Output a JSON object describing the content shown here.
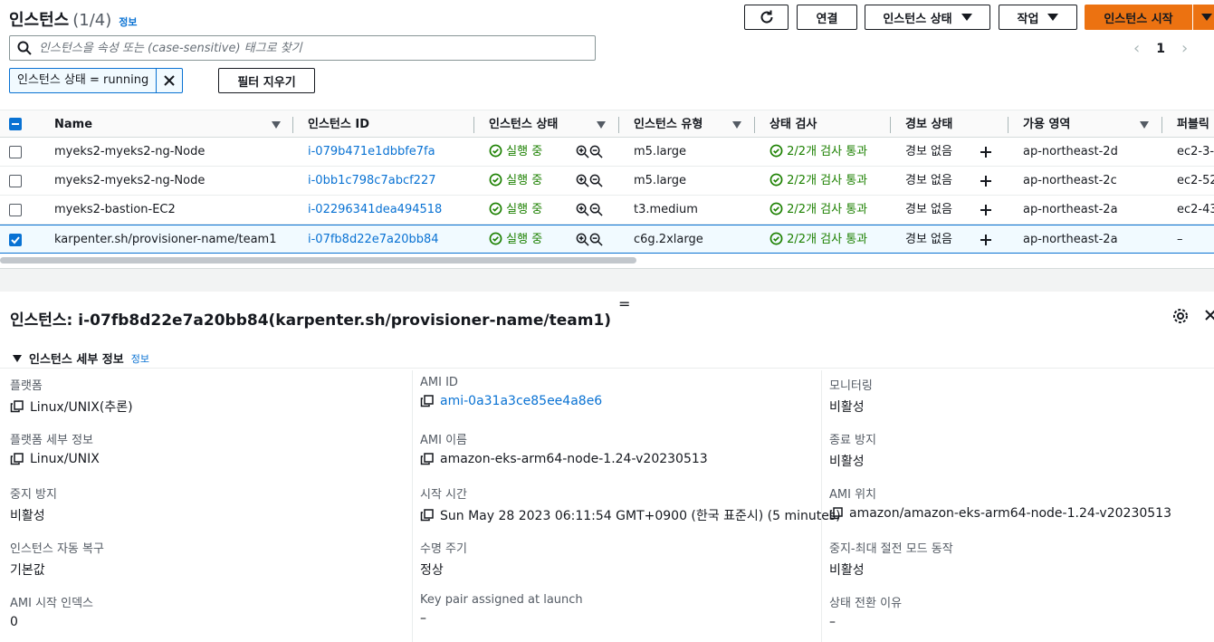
{
  "header": {
    "title": "인스턴스",
    "count": "(1/4)",
    "info": "정보"
  },
  "toolbar": {
    "connect": "연결",
    "instance_state": "인스턴스 상태",
    "actions": "작업",
    "launch": "인스턴스 시작"
  },
  "search": {
    "placeholder": "인스턴스을 속성 또는 (case-sensitive) 태그로 찾기"
  },
  "pagination": {
    "page": "1"
  },
  "filter": {
    "token": "인스턴스 상태 = running",
    "clear": "필터 지우기"
  },
  "table": {
    "columns": [
      "Name",
      "인스턴스 ID",
      "인스턴스 상태",
      "인스턴스 유형",
      "상태 검사",
      "경보 상태",
      "가용 영역",
      "퍼블릭"
    ],
    "rows": [
      {
        "name": "myeks2-myeks2-ng-Node",
        "id": "i-079b471e1dbbfe7fa",
        "state": "실행 중",
        "type": "m5.large",
        "check": "2/2개 검사 통과",
        "alarm": "경보 없음",
        "az": "ap-northeast-2d",
        "public": "ec2-3-",
        "selected": false
      },
      {
        "name": "myeks2-myeks2-ng-Node",
        "id": "i-0bb1c798c7abcf227",
        "state": "실행 중",
        "type": "m5.large",
        "check": "2/2개 검사 통과",
        "alarm": "경보 없음",
        "az": "ap-northeast-2c",
        "public": "ec2-52",
        "selected": false
      },
      {
        "name": "myeks2-bastion-EC2",
        "id": "i-02296341dea494518",
        "state": "실행 중",
        "type": "t3.medium",
        "check": "2/2개 검사 통과",
        "alarm": "경보 없음",
        "az": "ap-northeast-2a",
        "public": "ec2-43",
        "selected": false
      },
      {
        "name": "karpenter.sh/provisioner-name/team1",
        "id": "i-07fb8d22e7a20bb84",
        "state": "실행 중",
        "type": "c6g.2xlarge",
        "check": "2/2개 검사 통과",
        "alarm": "경보 없음",
        "az": "ap-northeast-2a",
        "public": "–",
        "selected": true
      }
    ]
  },
  "detail": {
    "title": "인스턴스: i-07fb8d22e7a20bb84(karpenter.sh/provisioner-name/team1)",
    "section": "인스턴스 세부 정보",
    "section_info": "정보",
    "col1": [
      {
        "label": "플랫폼",
        "value": "Linux/UNIX(추론)",
        "copy": true
      },
      {
        "label": "플랫폼 세부 정보",
        "value": "Linux/UNIX",
        "copy": true
      },
      {
        "label": "중지 방지",
        "value": "비활성",
        "copy": false
      },
      {
        "label": "인스턴스 자동 복구",
        "value": "기본값",
        "copy": false
      },
      {
        "label": "AMI 시작 인덱스",
        "value": "0",
        "copy": false
      }
    ],
    "col2": [
      {
        "label": "AMI ID",
        "value": "ami-0a31a3ce85ee4a8e6",
        "copy": true,
        "link": true
      },
      {
        "label": "AMI 이름",
        "value": "amazon-eks-arm64-node-1.24-v20230513",
        "copy": true
      },
      {
        "label": "시작 시간",
        "value": "Sun May 28 2023 06:11:54 GMT+0900 (한국 표준시) (5 minutes)",
        "copy": true
      },
      {
        "label": "수명 주기",
        "value": "정상",
        "copy": false
      },
      {
        "label": "Key pair assigned at launch",
        "value": "–",
        "copy": false
      }
    ],
    "col3": [
      {
        "label": "모니터링",
        "value": "비활성",
        "copy": false
      },
      {
        "label": "종료 방지",
        "value": "비활성",
        "copy": false
      },
      {
        "label": "AMI 위치",
        "value": "amazon/amazon-eks-arm64-node-1.24-v20230513",
        "copy": true
      },
      {
        "label": "중지-최대 절전 모드 동작",
        "value": "비활성",
        "copy": false
      },
      {
        "label": "상태 전환 이유",
        "value": "–",
        "copy": false
      }
    ]
  },
  "colors": {
    "accent": "#0972d3",
    "primary_button": "#ec7211",
    "success": "#1d8102"
  }
}
